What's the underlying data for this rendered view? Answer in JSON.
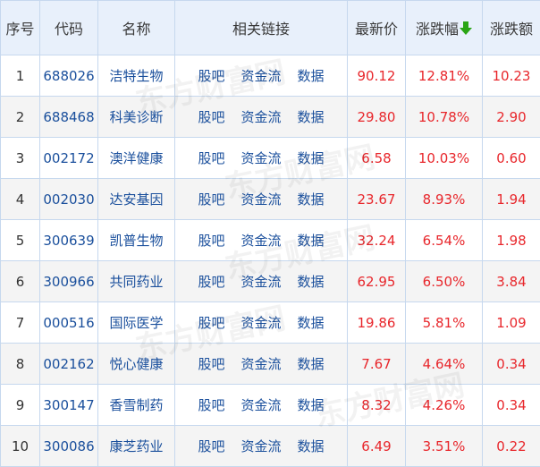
{
  "table": {
    "headers": {
      "index": "序号",
      "code": "代码",
      "name": "名称",
      "links": "相关链接",
      "price": "最新价",
      "change_pct": "涨跌幅",
      "change_amt": "涨跌额"
    },
    "sort_icon": "arrow-down-icon",
    "link_labels": {
      "guba": "股吧",
      "fund_flow": "资金流",
      "data": "数据"
    },
    "rows": [
      {
        "index": "1",
        "code": "688026",
        "name": "洁特生物",
        "price": "90.12",
        "change_pct": "12.81%",
        "change_amt": "10.23"
      },
      {
        "index": "2",
        "code": "688468",
        "name": "科美诊断",
        "price": "29.80",
        "change_pct": "10.78%",
        "change_amt": "2.90"
      },
      {
        "index": "3",
        "code": "002172",
        "name": "澳洋健康",
        "price": "6.58",
        "change_pct": "10.03%",
        "change_amt": "0.60"
      },
      {
        "index": "4",
        "code": "002030",
        "name": "达安基因",
        "price": "23.67",
        "change_pct": "8.93%",
        "change_amt": "1.94"
      },
      {
        "index": "5",
        "code": "300639",
        "name": "凯普生物",
        "price": "32.24",
        "change_pct": "6.54%",
        "change_amt": "1.98"
      },
      {
        "index": "6",
        "code": "300966",
        "name": "共同药业",
        "price": "62.95",
        "change_pct": "6.50%",
        "change_amt": "3.84"
      },
      {
        "index": "7",
        "code": "000516",
        "name": "国际医学",
        "price": "19.86",
        "change_pct": "5.81%",
        "change_amt": "1.09"
      },
      {
        "index": "8",
        "code": "002162",
        "name": "悦心健康",
        "price": "7.67",
        "change_pct": "4.64%",
        "change_amt": "0.34"
      },
      {
        "index": "9",
        "code": "300147",
        "name": "香雪制药",
        "price": "8.32",
        "change_pct": "4.26%",
        "change_amt": "0.34"
      },
      {
        "index": "10",
        "code": "300086",
        "name": "康芝药业",
        "price": "6.49",
        "change_pct": "3.51%",
        "change_amt": "0.22"
      }
    ]
  },
  "watermark": {
    "text": "东方财富网"
  },
  "colors": {
    "up": "#e8262b",
    "link": "#1a4f9c",
    "header_bg": "#e8f0fb",
    "border": "#c6d8ee",
    "sort_arrow": "#2aa515"
  }
}
